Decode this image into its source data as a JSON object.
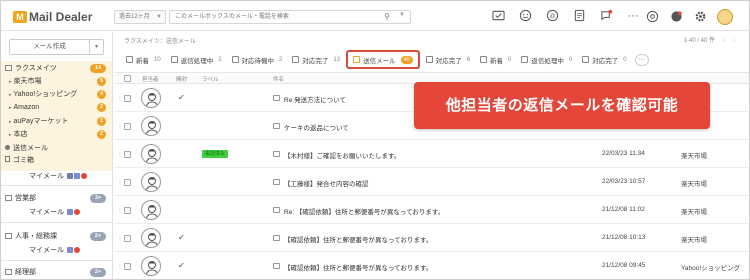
{
  "app": {
    "logo_mark": "M",
    "logo_text": "Mail Dealer"
  },
  "header": {
    "period": "過去12ヶ月",
    "search_placeholder": "このメールボックスのメール・電話を検索"
  },
  "sidebar": {
    "compose_label": "メール作成",
    "folders": [
      {
        "label": "ラクスメイツ",
        "badge": "14",
        "top": true
      },
      {
        "label": "楽天市場",
        "badge": "5"
      },
      {
        "label": "Yahoo!ショッピング",
        "badge": "4"
      },
      {
        "label": "Amazon",
        "badge": "2"
      },
      {
        "label": "auPayマーケット",
        "badge": "1"
      },
      {
        "label": "本店",
        "badge": "2"
      }
    ],
    "special": [
      {
        "label": "送信メール"
      },
      {
        "label": "ゴミ箱"
      }
    ],
    "my_mail_label": "マイメール",
    "groups": [
      {
        "label": "営業部",
        "badge": "3+",
        "sub": "マイメール"
      },
      {
        "label": "人事・総務課",
        "badge": "2+",
        "sub": "マイメール"
      },
      {
        "label": "経理部",
        "badge": "2+"
      }
    ]
  },
  "main": {
    "breadcrumb": "ラクスメイツ：送信メール",
    "pager": "1-40 / 40 件",
    "tabs": [
      {
        "label": "新着",
        "count": "10"
      },
      {
        "label": "返信処理中",
        "count": "2"
      },
      {
        "label": "対応待機中",
        "count": "2"
      },
      {
        "label": "対応完了",
        "count": "13"
      },
      {
        "label": "送信メール",
        "count": "40",
        "active": true
      },
      {
        "label": "対応完了",
        "count": "6"
      },
      {
        "label": "新着",
        "count": "0"
      },
      {
        "label": "返信処理中",
        "count": "0"
      },
      {
        "label": "対応完了",
        "count": "0"
      }
    ],
    "columns": {
      "assignee": "担当者",
      "status": "開封",
      "label": "ラベル",
      "subject": "件名"
    },
    "rows": [
      {
        "subject": "Re:発送方法について",
        "date": "",
        "shop": "",
        "checked": true,
        "label": ""
      },
      {
        "subject": "ケーキの返品について",
        "date": "",
        "shop": "",
        "checked": false,
        "label": ""
      },
      {
        "subject": "【木村様】ご確認をお願いいたします。",
        "date": "22/03/23 11:34",
        "shop": "楽天市場",
        "checked": false,
        "label": "来店済み"
      },
      {
        "subject": "【工藤様】発合せ内容の確認",
        "date": "22/03/23 10:57",
        "shop": "楽天市場",
        "checked": false,
        "label": ""
      },
      {
        "subject": "Re: 【確認依頼】住所と郵便番号が異なっております。",
        "date": "21/12/08 11:02",
        "shop": "楽天市場",
        "checked": false,
        "label": ""
      },
      {
        "subject": "【確認依頼】住所と郵便番号が異なっております。",
        "date": "21/12/08 10:13",
        "shop": "楽天市場",
        "checked": true,
        "label": ""
      },
      {
        "subject": "【確認依頼】住所と郵便番号が異なっております。",
        "date": "21/12/08 09:45",
        "shop": "Yahoo!ショッピング",
        "checked": true,
        "label": ""
      }
    ]
  },
  "callout": {
    "text": "他担当者の返信メールを確認可能"
  },
  "colors": {
    "accent": "#e4473a",
    "badge": "#f0a125",
    "folder_bg": "#fdf4df",
    "label_green": "#3ecf3e"
  },
  "icons": [
    "search-icon",
    "mail-check-icon",
    "smile-icon",
    "at-icon",
    "document-icon",
    "chat-icon",
    "more-icon",
    "at-sign-icon",
    "notification-icon",
    "gear-icon",
    "user-avatar-icon"
  ]
}
